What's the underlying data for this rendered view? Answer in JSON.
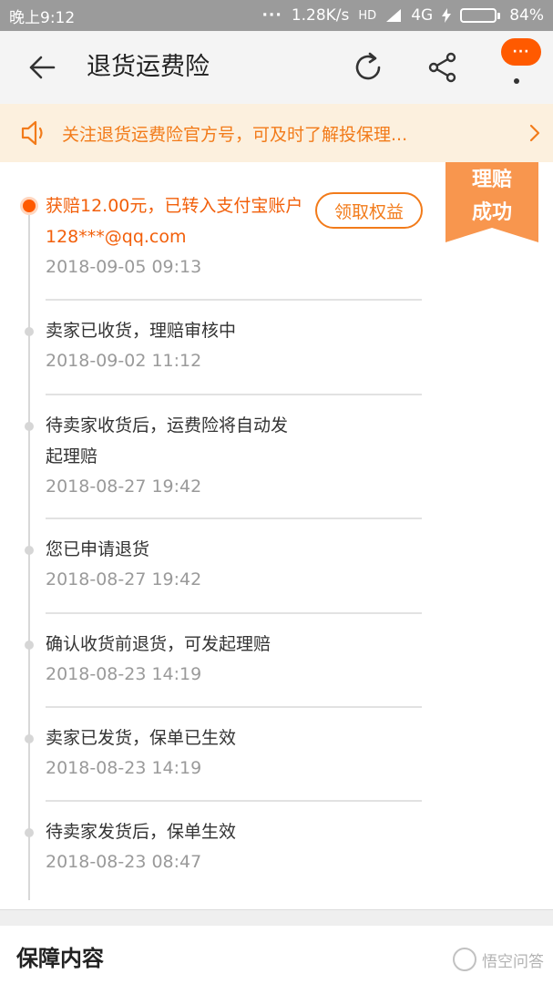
{
  "status_bar": {
    "time": "晚上9:12",
    "speed": "1.28K/s",
    "hd": "HD",
    "network": "4G",
    "battery_text": "84%",
    "battery_level": 0.84,
    "dots": "···"
  },
  "header": {
    "title": "退货运费险",
    "back_icon": "arrow-left-icon",
    "refresh_icon": "refresh-icon",
    "share_icon": "share-icon",
    "more_badge": "···"
  },
  "notice": {
    "text": "关注退货运费险官方号，可及时了解投保理...",
    "icon": "speaker-icon"
  },
  "ribbon": {
    "line1": "理赔",
    "line2": "成功",
    "color": "#f8964e"
  },
  "events": [
    {
      "title": "获赔12.00元，已转入支付宝账户",
      "sub": "128***@qq.com",
      "time": "2018-09-05 09:13",
      "button": "领取权益"
    },
    {
      "title": "卖家已收货，理赔审核中",
      "time": "2018-09-02 11:12"
    },
    {
      "title": "待卖家收货后，运费险将自动发",
      "title2": "起理赔",
      "time": "2018-08-27 19:42"
    },
    {
      "title": "您已申请退货",
      "time": "2018-08-27 19:42"
    },
    {
      "title": "确认收货前退货，可发起理赔",
      "time": "2018-08-23 14:19"
    },
    {
      "title": "卖家已发货，保单已生效",
      "time": "2018-08-23 14:19"
    },
    {
      "title": "待卖家发货后，保单生效",
      "time": "2018-08-23 08:47"
    }
  ],
  "section": {
    "title": "保障内容"
  },
  "watermark": {
    "text": "悟空问答"
  },
  "colors": {
    "accent": "#ff5a00",
    "accent_text": "#f25f0a",
    "notice_bg": "#fcf0de"
  }
}
